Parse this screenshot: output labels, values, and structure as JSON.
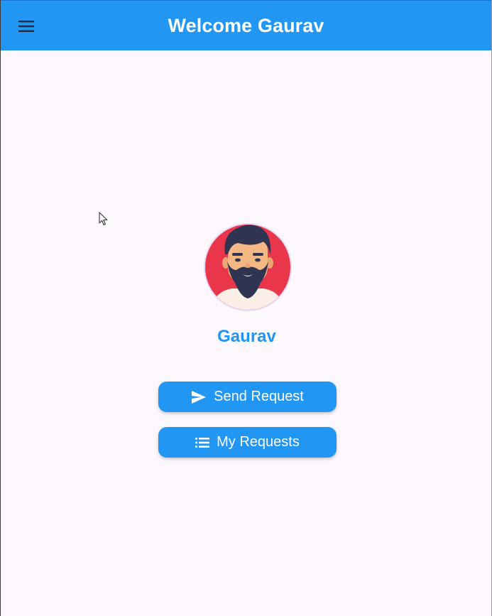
{
  "appbar": {
    "title": "Welcome Gaurav",
    "menu_icon": "hamburger-menu-icon",
    "background": "#2196f3"
  },
  "profile": {
    "name": "Gaurav",
    "avatar_icon": "bearded-man-avatar-icon"
  },
  "actions": {
    "send_request": {
      "label": "Send Request",
      "icon": "send-icon"
    },
    "my_requests": {
      "label": "My Requests",
      "icon": "list-icon"
    }
  },
  "colors": {
    "primary": "#2196f3",
    "background": "#fdf7fe",
    "avatar_bg": "#e9364b"
  }
}
